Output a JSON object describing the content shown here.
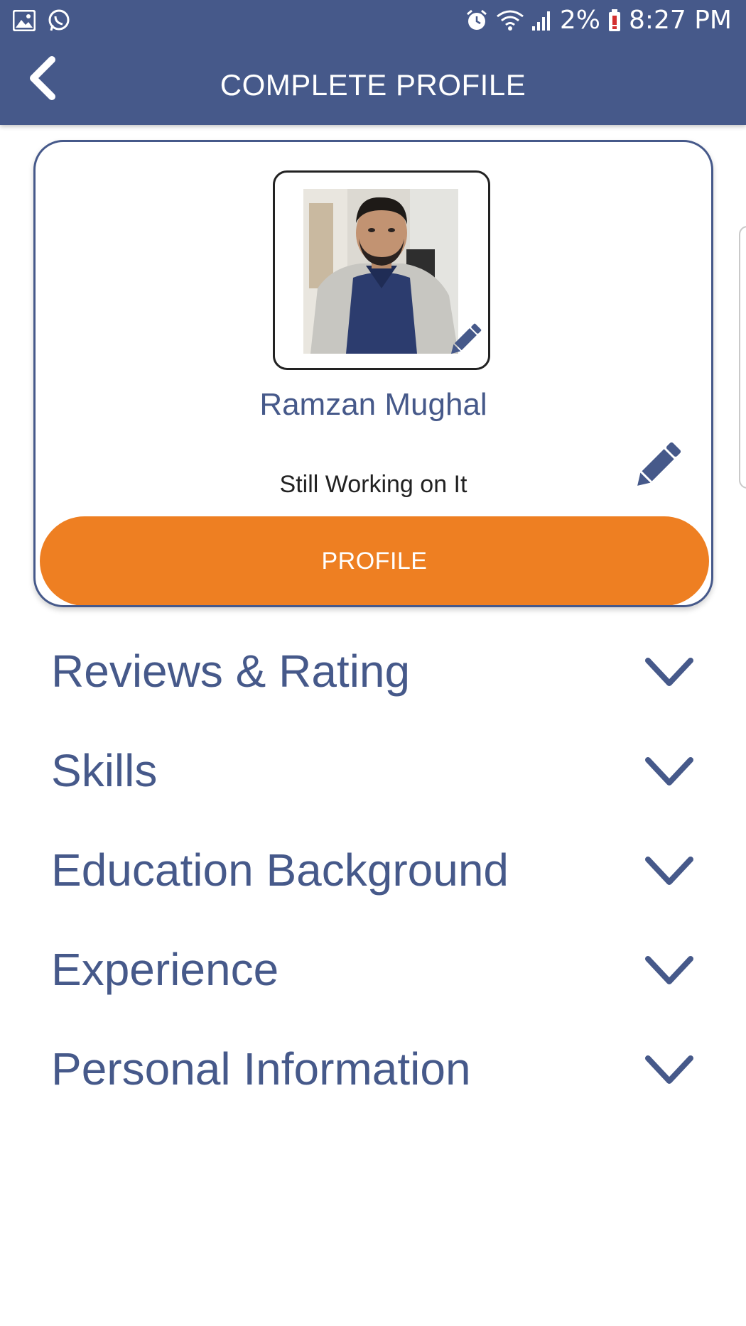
{
  "status_bar": {
    "battery": "2%",
    "time": "8:27 PM",
    "left_icons": [
      "gallery-icon",
      "whatsapp-icon"
    ],
    "right_icons": [
      "alarm-icon",
      "wifi-icon",
      "signal-icon",
      "battery-low-icon"
    ]
  },
  "header": {
    "title": "COMPLETE PROFILE",
    "back_icon": "chevron-left-icon"
  },
  "profile": {
    "name": "Ramzan Mughal",
    "status": "Still Working on It",
    "button_label": "PROFILE",
    "edit_icon": "pencil-icon"
  },
  "sections": [
    {
      "label": "Reviews & Rating"
    },
    {
      "label": "Skills"
    },
    {
      "label": "Education Background"
    },
    {
      "label": "Experience"
    },
    {
      "label": "Personal Information"
    }
  ],
  "colors": {
    "primary": "#46598a",
    "accent": "#ee7f22",
    "background": "#ffffff",
    "text_dark": "#222222"
  }
}
